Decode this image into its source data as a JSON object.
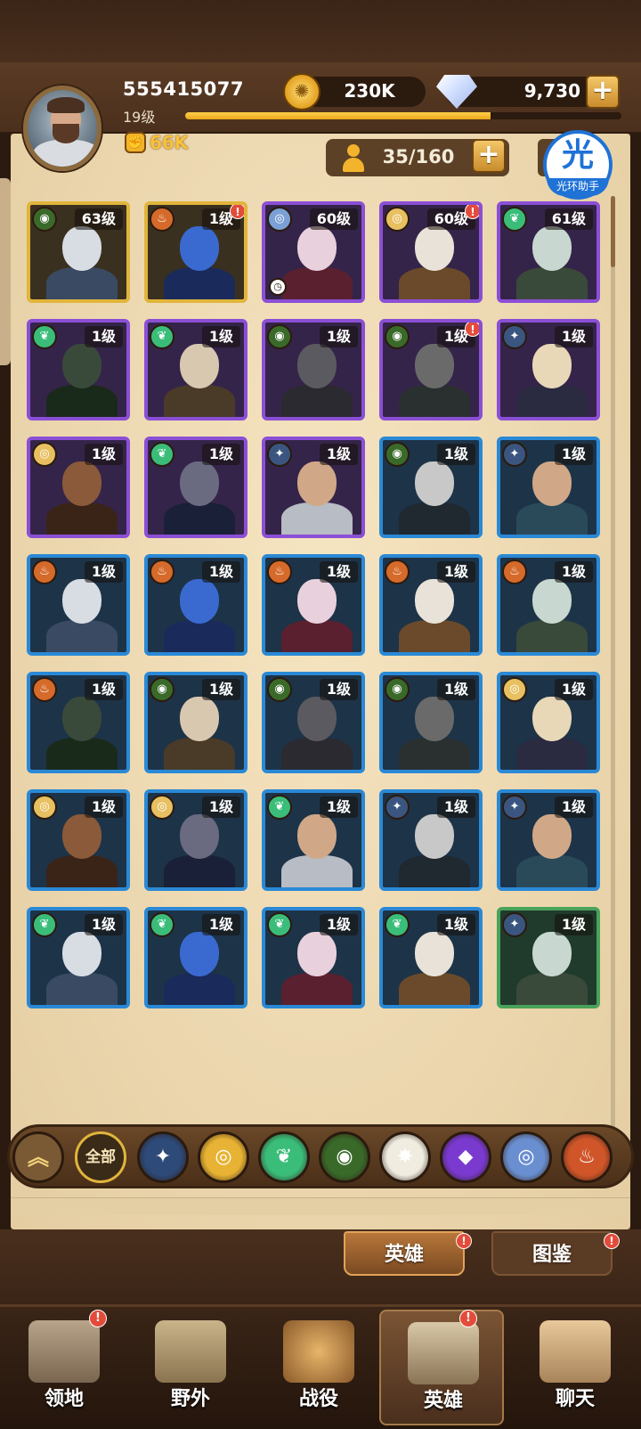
{
  "player": {
    "id": "555415077",
    "level": "19级",
    "power": "66K",
    "xp_progress": 0.7
  },
  "resources": {
    "gold": "230K",
    "diamonds": "9,730",
    "plus": "+"
  },
  "roster": {
    "count": "35/160",
    "plus": "+"
  },
  "helper": {
    "glyph": "光",
    "label": "光环助手"
  },
  "heroes": [
    {
      "level": "63级",
      "faction": "graveborn",
      "frame": "gold",
      "alert": false
    },
    {
      "level": "1级",
      "faction": "mauler",
      "frame": "gold",
      "alert": true
    },
    {
      "level": "60级",
      "faction": "dimensional",
      "frame": "purple",
      "alert": false,
      "timer": true
    },
    {
      "level": "60级",
      "faction": "lightbearer",
      "frame": "purple",
      "alert": true
    },
    {
      "level": "61级",
      "faction": "wilder",
      "frame": "purple",
      "alert": false
    },
    {
      "level": "1级",
      "faction": "wilder",
      "frame": "purple",
      "alert": false
    },
    {
      "level": "1级",
      "faction": "wilder",
      "frame": "purple",
      "alert": false
    },
    {
      "level": "1级",
      "faction": "graveborn",
      "frame": "purple",
      "alert": false
    },
    {
      "level": "1级",
      "faction": "graveborn",
      "frame": "purple",
      "alert": true
    },
    {
      "level": "1级",
      "faction": "celestial-lb",
      "frame": "purple",
      "alert": false
    },
    {
      "level": "1级",
      "faction": "lightbearer",
      "frame": "purple",
      "alert": false
    },
    {
      "level": "1级",
      "faction": "wilder",
      "frame": "purple",
      "alert": false
    },
    {
      "level": "1级",
      "faction": "celestial-lb",
      "frame": "purple",
      "alert": false
    },
    {
      "level": "1级",
      "faction": "graveborn",
      "frame": "blue",
      "alert": false
    },
    {
      "level": "1级",
      "faction": "celestial-lb",
      "frame": "blue",
      "alert": false
    },
    {
      "level": "1级",
      "faction": "mauler",
      "frame": "blue",
      "alert": false
    },
    {
      "level": "1级",
      "faction": "mauler",
      "frame": "blue",
      "alert": false
    },
    {
      "level": "1级",
      "faction": "mauler",
      "frame": "blue",
      "alert": false
    },
    {
      "level": "1级",
      "faction": "mauler",
      "frame": "blue",
      "alert": false
    },
    {
      "level": "1级",
      "faction": "mauler",
      "frame": "blue",
      "alert": false
    },
    {
      "level": "1级",
      "faction": "mauler",
      "frame": "blue",
      "alert": false
    },
    {
      "level": "1级",
      "faction": "graveborn",
      "frame": "blue",
      "alert": false
    },
    {
      "level": "1级",
      "faction": "graveborn",
      "frame": "blue",
      "alert": false
    },
    {
      "level": "1级",
      "faction": "graveborn",
      "frame": "blue",
      "alert": false
    },
    {
      "level": "1级",
      "faction": "lightbearer",
      "frame": "blue",
      "alert": false
    },
    {
      "level": "1级",
      "faction": "lightbearer",
      "frame": "blue",
      "alert": false
    },
    {
      "level": "1级",
      "faction": "lightbearer",
      "frame": "blue",
      "alert": false
    },
    {
      "level": "1级",
      "faction": "wilder",
      "frame": "blue",
      "alert": false
    },
    {
      "level": "1级",
      "faction": "celestial-lb",
      "frame": "blue",
      "alert": false
    },
    {
      "level": "1级",
      "faction": "celestial-lb",
      "frame": "blue",
      "alert": false
    },
    {
      "level": "1级",
      "faction": "wilder",
      "frame": "blue",
      "alert": false
    },
    {
      "level": "1级",
      "faction": "wilder",
      "frame": "blue",
      "alert": false
    },
    {
      "level": "1级",
      "faction": "wilder",
      "frame": "blue",
      "alert": false
    },
    {
      "level": "1级",
      "faction": "wilder",
      "frame": "blue",
      "alert": false
    },
    {
      "level": "1级",
      "faction": "celestial-lb",
      "frame": "green",
      "alert": false
    }
  ],
  "filters": [
    {
      "name": "collapse-filter",
      "label": "︽",
      "kind": "up"
    },
    {
      "name": "all-filter",
      "label": "全部",
      "kind": "all"
    },
    {
      "name": "lightbearer-filter",
      "label": "✦",
      "color": "#2d4a78"
    },
    {
      "name": "mauler-filter",
      "label": "◎",
      "color": "#e8b334"
    },
    {
      "name": "wilder-filter",
      "label": "❦",
      "color": "#3bbd7a"
    },
    {
      "name": "graveborn-filter",
      "label": "◉",
      "color": "#3a6a2a"
    },
    {
      "name": "celestial-filter",
      "label": "✸",
      "color": "#f0ece0"
    },
    {
      "name": "hypogean-filter",
      "label": "◆",
      "color": "#7a3ad0"
    },
    {
      "name": "dimensional-filter",
      "label": "◎",
      "color": "#6a8fd0"
    },
    {
      "name": "mauler2-filter",
      "label": "♨",
      "color": "#d0562a"
    }
  ],
  "sub_tabs": {
    "heroes": "英雄",
    "codex": "图鉴"
  },
  "nav": {
    "territory": "领地",
    "wild": "野外",
    "campaign": "战役",
    "heroes": "英雄",
    "chat": "聊天"
  },
  "colors": {
    "panel": "#f1dfb9",
    "gold_frame": "#e1b53c",
    "purple_frame": "#8b4fd6",
    "blue_frame": "#2a89d6",
    "green_frame": "#49a35a",
    "alert": "#e34b3a"
  }
}
